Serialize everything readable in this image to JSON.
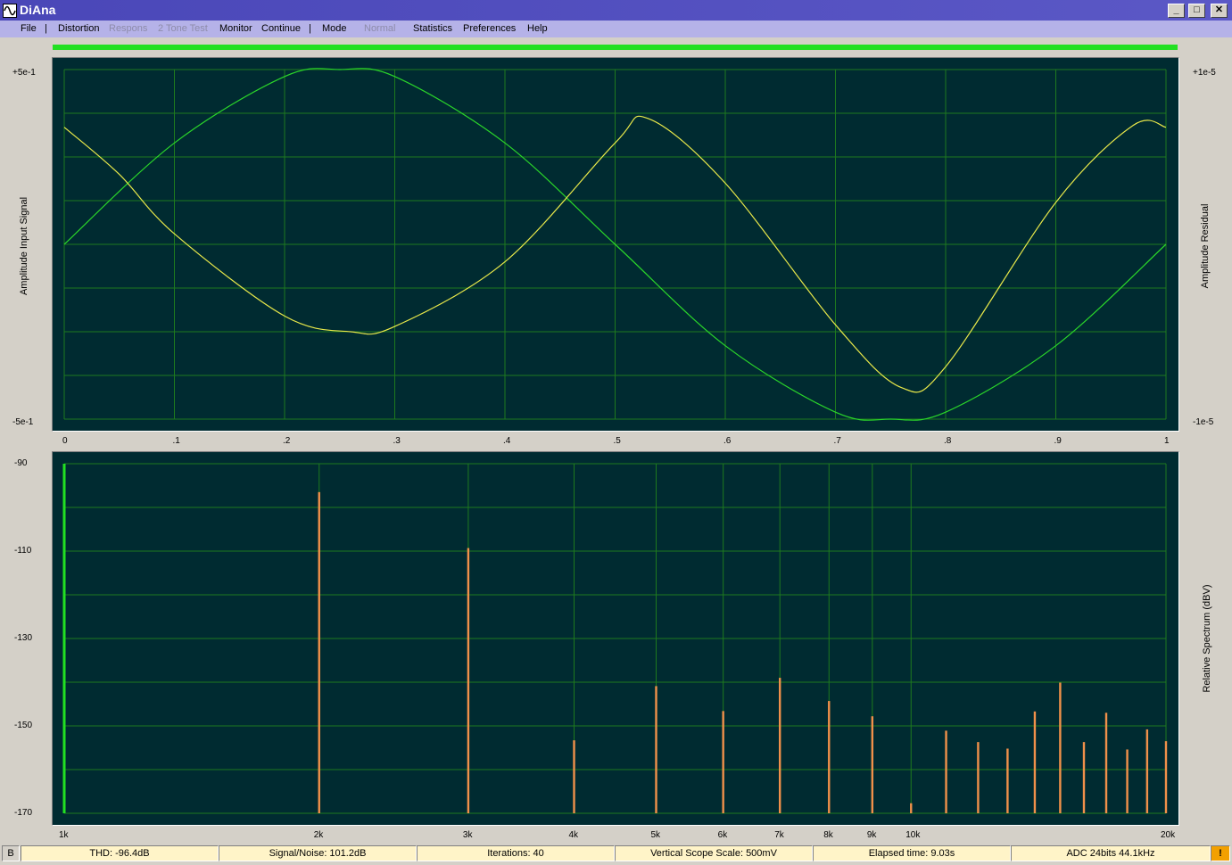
{
  "window": {
    "title": "DiAna",
    "minimize": "_",
    "maximize": "□",
    "close": "✕"
  },
  "menu": [
    {
      "label": "File",
      "enabled": true
    },
    {
      "label": "|",
      "sep": true
    },
    {
      "label": "Distortion",
      "enabled": true
    },
    {
      "label": "Respons",
      "enabled": false
    },
    {
      "label": "2 Tone Test",
      "enabled": false
    },
    {
      "label": "Monitor",
      "enabled": true
    },
    {
      "label": "Continue",
      "enabled": true
    },
    {
      "label": "|",
      "sep": true
    },
    {
      "label": "Mode",
      "enabled": true
    },
    {
      "label": "Normal",
      "enabled": false
    },
    {
      "label": "Statistics",
      "enabled": true
    },
    {
      "label": "Preferences",
      "enabled": true
    },
    {
      "label": "Help",
      "enabled": true
    }
  ],
  "progress": {
    "value": 1.0
  },
  "colors": {
    "plot_bg": "#002b31",
    "grid": "#1e7a1e",
    "input_trace": "#2ad62a",
    "residual_trace": "#e8e84a",
    "harmonic_bar": "#f0904a",
    "fundamental_bar": "#22e022"
  },
  "scope": {
    "y_left_label": "Amplitude Input Signal",
    "y_right_label": "Amplitude Residual",
    "y_left_top": "+5e-1",
    "y_left_bottom": "-5e-1",
    "y_right_top": "+1e-5",
    "y_right_bottom": "-1e-5",
    "x_ticks": [
      "0",
      ".1",
      ".2",
      ".3",
      ".4",
      ".5",
      ".6",
      ".7",
      ".8",
      ".9",
      "1"
    ]
  },
  "spectrum": {
    "y_label": "Relative Spectrum  (dBV)",
    "y_ticks": [
      "-90",
      "-110",
      "-130",
      "-150",
      "-170"
    ],
    "x_ticks": [
      "1k",
      "2k",
      "3k",
      "4k",
      "5k",
      "6k",
      "7k",
      "8k",
      "9k",
      "10k",
      "20k"
    ]
  },
  "chart_data": [
    {
      "type": "line",
      "title": "",
      "xlabel": "",
      "ylabel": "Amplitude Input Signal",
      "ylabel_right": "Amplitude Residual",
      "xlim": [
        0,
        1
      ],
      "ylim": [
        -0.5,
        0.5
      ],
      "ylim_right": [
        -1e-05,
        1e-05
      ],
      "grid": true,
      "series": [
        {
          "axis": "left",
          "x": [
            0,
            0.1,
            0.2,
            0.25,
            0.3,
            0.4,
            0.5,
            0.6,
            0.7,
            0.75,
            0.8,
            0.9,
            1.0
          ],
          "values": [
            0.0,
            0.29,
            0.48,
            0.5,
            0.48,
            0.29,
            0.0,
            -0.29,
            -0.48,
            -0.5,
            -0.48,
            -0.29,
            0.0
          ]
        },
        {
          "axis": "right",
          "x": [
            0,
            0.05,
            0.1,
            0.2,
            0.26,
            0.3,
            0.4,
            0.5,
            0.53,
            0.6,
            0.7,
            0.76,
            0.8,
            0.9,
            0.97,
            1.0
          ],
          "values": [
            6.7e-06,
            4e-06,
            6e-07,
            -4.1e-06,
            -5e-06,
            -4.7e-06,
            -1e-06,
            5.8e-06,
            7.2e-06,
            3.5e-06,
            -4.6e-06,
            -8.2e-06,
            -7e-06,
            2.4e-06,
            6.8e-06,
            6.7e-06
          ]
        }
      ]
    },
    {
      "type": "bar",
      "title": "",
      "xlabel": "",
      "ylabel": "Relative Spectrum  (dBV)",
      "x_scale": "log",
      "xlim": [
        1000,
        20000
      ],
      "ylim": [
        -170,
        -90
      ],
      "grid": true,
      "series": [
        {
          "x": [
            1000
          ],
          "values": [
            -90
          ]
        },
        {
          "x": [
            2000,
            3000,
            4000,
            5000,
            6000,
            7000,
            8000,
            9000,
            10000,
            11000,
            12000,
            13000,
            14000,
            15000,
            16000,
            17000,
            18000,
            19000,
            20000
          ],
          "values": [
            -96.5,
            -109.3,
            -153.3,
            -140.9,
            -146.6,
            -139,
            -144.3,
            -147.8,
            -167.7,
            -151.1,
            -153.7,
            -155.2,
            -146.7,
            -140.1,
            -153.7,
            -147,
            -155.4,
            -150.8,
            -153.5
          ]
        }
      ]
    }
  ],
  "status": {
    "mode_letter": "B",
    "thd": "THD:  -96.4dB",
    "snr": "Signal/Noise:  101.2dB",
    "iterations": "Iterations: 40",
    "vscale": "Vertical Scope Scale: 500mV",
    "elapsed": "Elapsed time: 9.03s",
    "adc": "ADC 24bits 44.1kHz",
    "warn": "!"
  }
}
